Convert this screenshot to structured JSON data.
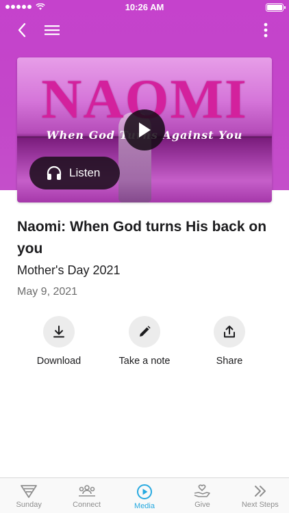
{
  "status": {
    "time": "10:26 AM"
  },
  "media": {
    "hero_title": "NAOMI",
    "hero_subtitle": "When God Turns Against You",
    "listen_label": "Listen",
    "title": "Naomi: When God turns His back on you",
    "series": "Mother's Day 2021",
    "date": "May 9, 2021"
  },
  "actions": [
    {
      "label": "Download",
      "icon": "download-icon"
    },
    {
      "label": "Take a note",
      "icon": "pencil-icon"
    },
    {
      "label": "Share",
      "icon": "share-icon"
    }
  ],
  "tabs": [
    {
      "label": "Sunday",
      "icon": "sunday-icon"
    },
    {
      "label": "Connect",
      "icon": "connect-icon"
    },
    {
      "label": "Media",
      "icon": "media-icon",
      "active": true
    },
    {
      "label": "Give",
      "icon": "give-icon"
    },
    {
      "label": "Next Steps",
      "icon": "next-steps-icon"
    }
  ],
  "colors": {
    "header": "#c542cc",
    "accent": "#26a9e0"
  }
}
